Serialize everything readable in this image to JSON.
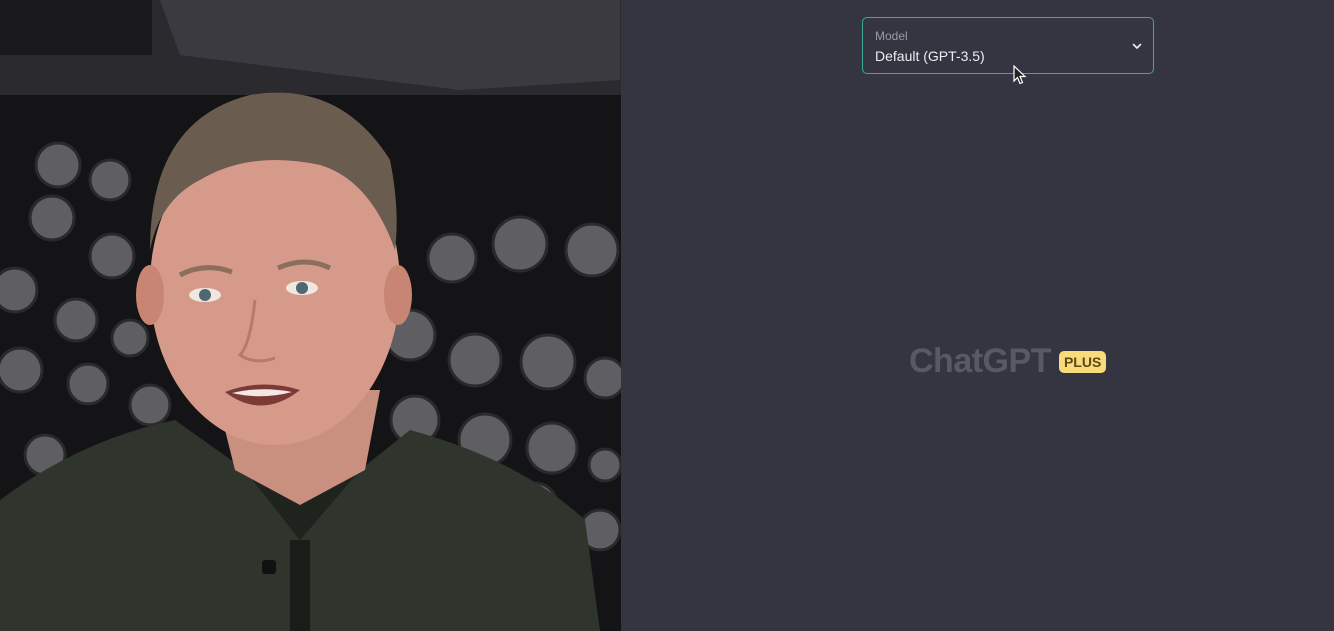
{
  "model_selector": {
    "label": "Model",
    "value": "Default (GPT-3.5)",
    "icon": "chevron-down-icon"
  },
  "brand": {
    "name": "ChatGPT",
    "badge": "PLUS"
  },
  "colors": {
    "app_background": "#343541",
    "select_border": "#3ea89a",
    "badge_background": "#f9db7a",
    "brand_text": "#585965"
  }
}
